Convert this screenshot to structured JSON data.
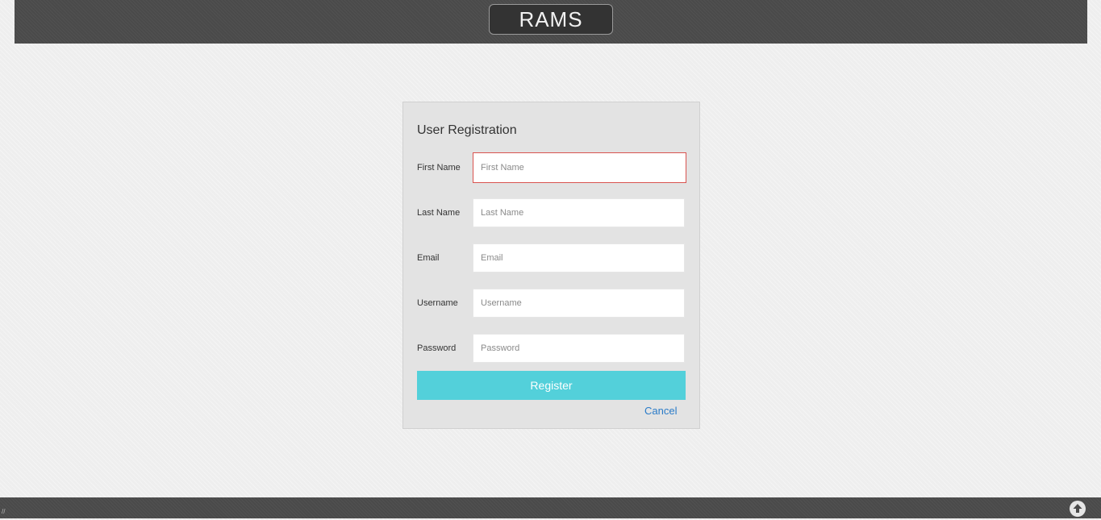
{
  "header": {
    "brand": "RAMS"
  },
  "form": {
    "title": "User Registration",
    "fields": [
      {
        "label": "First Name",
        "placeholder": "First Name",
        "value": ""
      },
      {
        "label": "Last Name",
        "placeholder": "Last Name",
        "value": ""
      },
      {
        "label": "Email",
        "placeholder": "Email",
        "value": ""
      },
      {
        "label": "Username",
        "placeholder": "Username",
        "value": ""
      },
      {
        "label": "Password",
        "placeholder": "Password",
        "value": ""
      }
    ],
    "register_label": "Register",
    "cancel_label": "Cancel"
  },
  "footer": {
    "mark": "//",
    "scroll_top_icon": "arrow-up-circle-icon"
  },
  "colors": {
    "accent": "#53d0da",
    "link": "#2a7bc8",
    "invalid_border": "#d9534f",
    "bar": "#4a4a4a"
  }
}
